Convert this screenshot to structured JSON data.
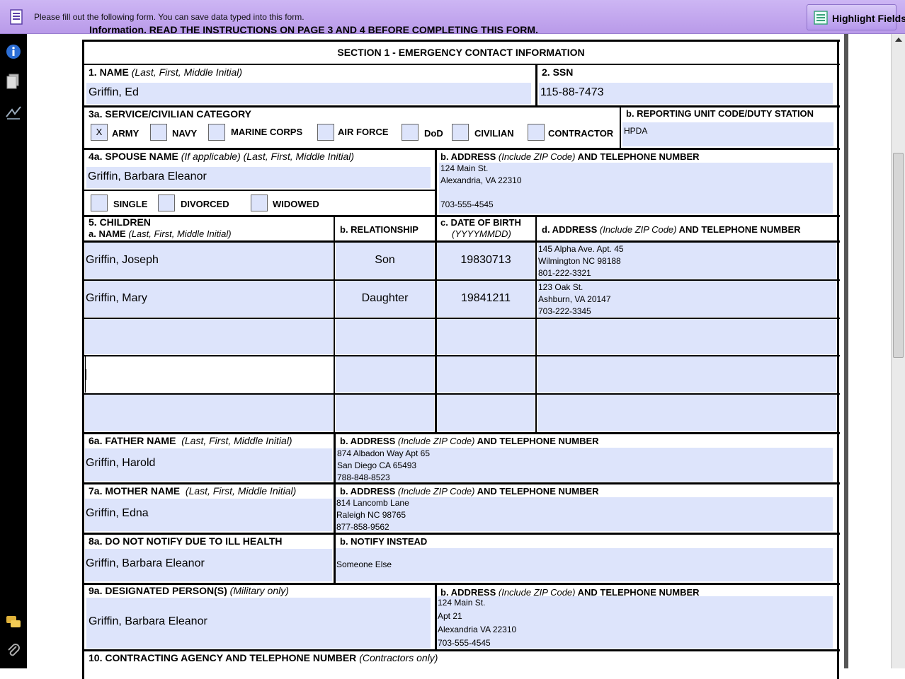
{
  "notice_bar": {
    "message": "Please fill out the following form. You can save data typed into this form.",
    "highlight_button": "Highlight Fields"
  },
  "sidebar_icons": [
    "info-icon",
    "pages-icon",
    "signature-icon",
    "comments-icon",
    "attachment-icon"
  ],
  "form": {
    "top_text": "Information.  READ THE INSTRUCTIONS ON PAGE 3 AND 4 BEFORE COMPLETING THIS FORM.",
    "section_title": "SECTION 1 - EMERGENCY CONTACT INFORMATION",
    "name": {
      "num": "1.  NAME",
      "hint": "(Last, First, Middle Initial)",
      "value": "Griffin, Ed"
    },
    "ssn": {
      "label": "2.  SSN",
      "value": "115-88-7473"
    },
    "category": {
      "label": "3a.  SERVICE/CIVILIAN CATEGORY",
      "options": [
        {
          "label": "ARMY",
          "mark": "X"
        },
        {
          "label": "NAVY",
          "mark": ""
        },
        {
          "label": "MARINE CORPS",
          "mark": ""
        },
        {
          "label": "AIR FORCE",
          "mark": ""
        },
        {
          "label": "DoD",
          "mark": ""
        },
        {
          "label": "CIVILIAN",
          "mark": ""
        },
        {
          "label": "CONTRACTOR",
          "mark": ""
        }
      ]
    },
    "unit": {
      "label": "b.  REPORTING UNIT CODE/DUTY STATION",
      "value": "HPDA"
    },
    "spouse": {
      "num": "4a.  SPOUSE NAME",
      "hint": "(If applicable) (Last, First, Middle Initial)",
      "value": "Griffin, Barbara Eleanor",
      "status_options": [
        "SINGLE",
        "DIVORCED",
        "WIDOWED"
      ],
      "addr_label": "b.  ADDRESS",
      "addr_hint": "(Include ZIP Code)",
      "addr_tail": "AND TELEPHONE NUMBER",
      "addr_lines": [
        "124 Main St.",
        "Alexandria, VA 22310",
        "",
        "703-555-4545"
      ]
    },
    "children": {
      "label": "5.  CHILDREN",
      "col_a": "a.    NAME",
      "col_a_hint": "(Last, First, Middle Initial)",
      "col_b": "b.  RELATIONSHIP",
      "col_c": "c.  DATE OF BIRTH",
      "col_c_hint": "(YYYYMMDD)",
      "col_d": "d.  ADDRESS",
      "col_d_hint": "(Include ZIP Code)",
      "col_d_tail": "AND TELEPHONE NUMBER",
      "rows": [
        {
          "name": "Griffin, Joseph",
          "rel": "Son",
          "dob": "19830713",
          "addr": [
            "145 Alpha Ave. Apt. 45",
            "Wilmington NC 98188",
            "801-222-3321"
          ]
        },
        {
          "name": "Griffin, Mary",
          "rel": "Daughter",
          "dob": "19841211",
          "addr": [
            " 123 Oak St.",
            "Ashburn, VA 20147",
            "703-222-3345"
          ]
        },
        {
          "name": "",
          "rel": "",
          "dob": "",
          "addr": [
            "",
            "",
            ""
          ]
        },
        {
          "name": "",
          "rel": "",
          "dob": "",
          "addr": [
            "",
            "",
            ""
          ]
        },
        {
          "name": "",
          "rel": "",
          "dob": "",
          "addr": [
            "",
            "",
            ""
          ]
        }
      ]
    },
    "father": {
      "num": "6a. FATHER NAME",
      "hint": "(Last, First, Middle Initial)",
      "value": "Griffin, Harold",
      "addr_label": "b.  ADDRESS",
      "addr_hint": "(Include ZIP Code)",
      "addr_tail": "AND TELEPHONE NUMBER",
      "addr_lines": [
        "874 Albadon Way Apt 65",
        "San Diego CA 65493",
        "788-848-8523"
      ]
    },
    "mother": {
      "num": "7a. MOTHER NAME",
      "hint": "(Last, First, Middle Initial)",
      "value": "Griffin, Edna",
      "addr_label": "b.  ADDRESS",
      "addr_hint": "(Include ZIP Code)",
      "addr_tail": "AND TELEPHONE NUMBER",
      "addr_lines": [
        "814 Lancomb Lane",
        "Raleigh NC 98765",
        "877-858-9562"
      ]
    },
    "do_not_notify": {
      "label": "8a. DO NOT NOTIFY DUE TO ILL HEALTH",
      "value": "Griffin, Barbara Eleanor",
      "notify_label": "b.  NOTIFY INSTEAD",
      "notify_value": "Someone Else"
    },
    "designated": {
      "num": "9a. DESIGNATED PERSON(S)",
      "hint": "(Military only)",
      "value": "Griffin, Barbara Eleanor",
      "addr_label": "b. ADDRESS",
      "addr_hint": "(Include ZIP Code)",
      "addr_tail": "AND TELEPHONE NUMBER",
      "addr_lines": [
        "124 Main St.",
        "Apt 21",
        "Alexandria VA 22310",
        "703-555-4545"
      ]
    },
    "contracting": {
      "num": "10. CONTRACTING AGENCY AND TELEPHONE NUMBER",
      "hint": "(Contractors only)"
    }
  }
}
